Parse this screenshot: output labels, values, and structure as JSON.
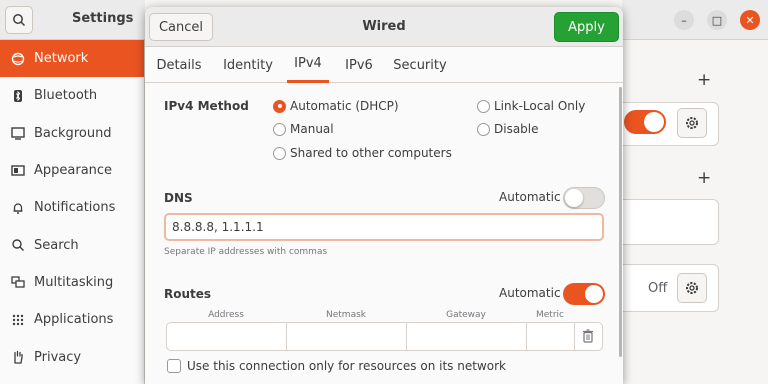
{
  "settings": {
    "title": "Settings",
    "sidebar": [
      {
        "label": "Network",
        "icon": "network-icon",
        "active": true
      },
      {
        "label": "Bluetooth",
        "icon": "bluetooth-icon"
      },
      {
        "label": "Background",
        "icon": "background-icon"
      },
      {
        "label": "Appearance",
        "icon": "appearance-icon"
      },
      {
        "label": "Notifications",
        "icon": "bell-icon"
      },
      {
        "label": "Search",
        "icon": "search-icon"
      },
      {
        "label": "Multitasking",
        "icon": "multitasking-icon"
      },
      {
        "label": "Applications",
        "icon": "grid-icon"
      },
      {
        "label": "Privacy",
        "icon": "hand-icon"
      }
    ],
    "off_label": "Off"
  },
  "dialog": {
    "title": "Wired",
    "cancel_label": "Cancel",
    "apply_label": "Apply",
    "tabs": [
      "Details",
      "Identity",
      "IPv4",
      "IPv6",
      "Security"
    ],
    "active_tab": "IPv4",
    "ipv4_method": {
      "label": "IPv4 Method",
      "options": [
        "Automatic (DHCP)",
        "Link-Local Only",
        "Manual",
        "Disable",
        "Shared to other computers"
      ],
      "selected": "Automatic (DHCP)"
    },
    "dns": {
      "label": "DNS",
      "automatic_label": "Automatic",
      "automatic_on": false,
      "value": "8.8.8.8, 1.1.1.1",
      "hint": "Separate IP addresses with commas"
    },
    "routes": {
      "label": "Routes",
      "automatic_label": "Automatic",
      "automatic_on": true,
      "columns": [
        "Address",
        "Netmask",
        "Gateway",
        "Metric"
      ]
    },
    "only_resources_label": "Use this connection only for resources on its network"
  },
  "colors": {
    "accent": "#e95420",
    "apply": "#26a234"
  }
}
